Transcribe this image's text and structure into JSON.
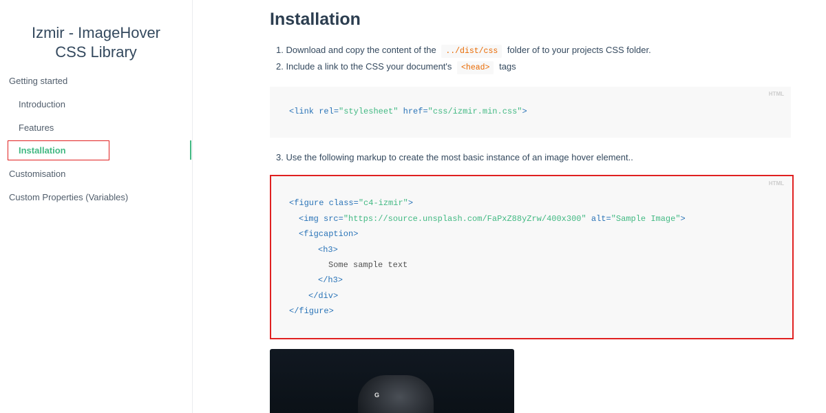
{
  "sidebar": {
    "app_title_line1": "Izmir - ImageHover",
    "app_title_line2": "CSS Library",
    "items": [
      {
        "label": "Getting started"
      },
      {
        "label": "Introduction"
      },
      {
        "label": "Features"
      },
      {
        "label": "Installation"
      },
      {
        "label": "Customisation"
      },
      {
        "label": "Custom Properties (Variables)"
      }
    ],
    "active_color": "#42b983"
  },
  "main": {
    "title": "Installation",
    "step1": {
      "prefix": "1. Download and copy the content of the",
      "code": "../dist/css",
      "suffix": "folder of to your projects CSS folder."
    },
    "step2": {
      "prefix": "2. Include a link to the CSS your document's",
      "code": "<head>",
      "suffix": "tags"
    },
    "step3": "3. Use the following markup to create the most basic instance of an image hover element..",
    "code1": {
      "lang": "HTML",
      "line": {
        "open": "<link",
        "attr1": "rel=",
        "val1": "\"stylesheet\"",
        "attr2": "href=",
        "val2": "\"css/izmir.min.css\"",
        "close": ">"
      }
    },
    "code2": {
      "lang": "HTML",
      "l1": {
        "open": "<figure",
        "attr": "class=",
        "val": "\"c4-izmir\"",
        "close": ">"
      },
      "l2": {
        "open": "<img",
        "attr1": "src=",
        "val1": "\"https://source.unsplash.com/FaPxZ88yZrw/400x300\"",
        "attr2": "alt=",
        "val2": "\"Sample Image\"",
        "close": ">"
      },
      "l3": "<figcaption>",
      "l4": "<h3>",
      "l5": "Some sample text",
      "l6": "</h3>",
      "l7": "</div>",
      "l8": "</figure>"
    },
    "preview_logo": "G"
  }
}
